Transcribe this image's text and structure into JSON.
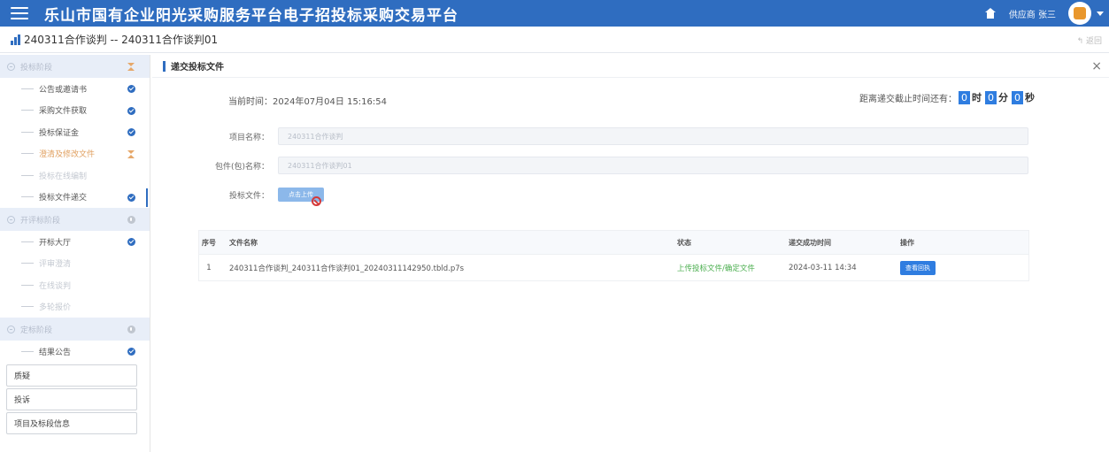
{
  "header": {
    "title": "乐山市国有企业阳光采购服务平台电子招投标采购交易平台",
    "user_label": "供应商 张三"
  },
  "subheader": {
    "breadcrumb": "240311合作谈判 -- 240311合作谈判01",
    "back_label": "返回"
  },
  "sidebar": {
    "stages": [
      {
        "label": "投标阶段",
        "status": "pending"
      },
      {
        "label": "开评标阶段",
        "status": "info"
      },
      {
        "label": "定标阶段",
        "status": "info"
      }
    ],
    "steps_bid": [
      {
        "label": "公告或邀请书",
        "state": "done"
      },
      {
        "label": "采购文件获取",
        "state": "done"
      },
      {
        "label": "投标保证金",
        "state": "done"
      },
      {
        "label": "澄清及修改文件",
        "state": "pending"
      },
      {
        "label": "投标在线编制",
        "state": "disabled"
      },
      {
        "label": "投标文件递交",
        "state": "done"
      }
    ],
    "steps_open": [
      {
        "label": "开标大厅",
        "state": "done"
      },
      {
        "label": "评审澄清",
        "state": "disabled"
      },
      {
        "label": "在线谈判",
        "state": "disabled"
      },
      {
        "label": "多轮报价",
        "state": "disabled"
      }
    ],
    "steps_award": [
      {
        "label": "结果公告",
        "state": "done"
      }
    ],
    "buttons": [
      "质疑",
      "投诉",
      "项目及标段信息"
    ]
  },
  "panel": {
    "title": "递交投标文件",
    "current_time_label": "当前时间：",
    "current_time": "2024年07月04日 15:16:54",
    "countdown_label": "距离递交截止时间还有：",
    "countdown": {
      "hours": "0",
      "hours_unit": "时",
      "minutes": "0",
      "minutes_unit": "分",
      "seconds": "0",
      "seconds_unit": "秒"
    },
    "form": {
      "project_label": "项目名称：",
      "project_value": "240311合作谈判",
      "package_label": "包件(包)名称：",
      "package_value": "240311合作谈判01",
      "file_label": "投标文件：",
      "upload_label": "点击上传"
    },
    "table": {
      "headers": [
        "序号",
        "文件名称",
        "状态",
        "递交成功时间",
        "操作"
      ],
      "rows": [
        {
          "idx": "1",
          "name": "240311合作谈判_240311合作谈判01_20240311142950.tbld.p7s",
          "status": "上传投标文件/确定文件",
          "time": "2024-03-11 14:34",
          "op": "查看回执"
        }
      ]
    }
  }
}
